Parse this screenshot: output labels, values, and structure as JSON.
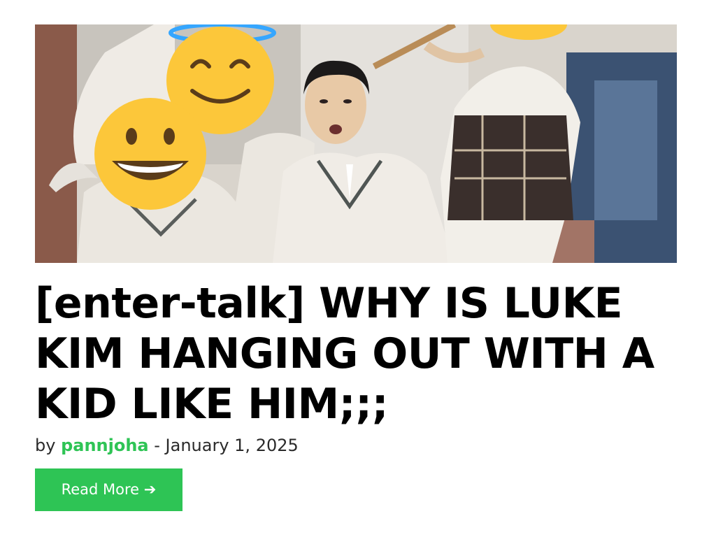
{
  "post": {
    "image": {
      "subject": "group photo of students in school uniforms with faces covered by emoji",
      "emojis": [
        "halo-smiling-emoji",
        "grinning-emoji",
        "smiling-emoji"
      ]
    },
    "title": "[enter-talk] WHY IS LUKE KIM HANGING OUT WITH A KID LIKE HIM;;;",
    "meta": {
      "by": "by",
      "author": "pannjoha",
      "separator": " - ",
      "date": "January 1, 2025"
    },
    "read_more": {
      "label": "Read More",
      "arrow": "➔"
    }
  },
  "colors": {
    "accent": "#2ec455",
    "title": "#000000",
    "text": "#2a2a2a"
  }
}
